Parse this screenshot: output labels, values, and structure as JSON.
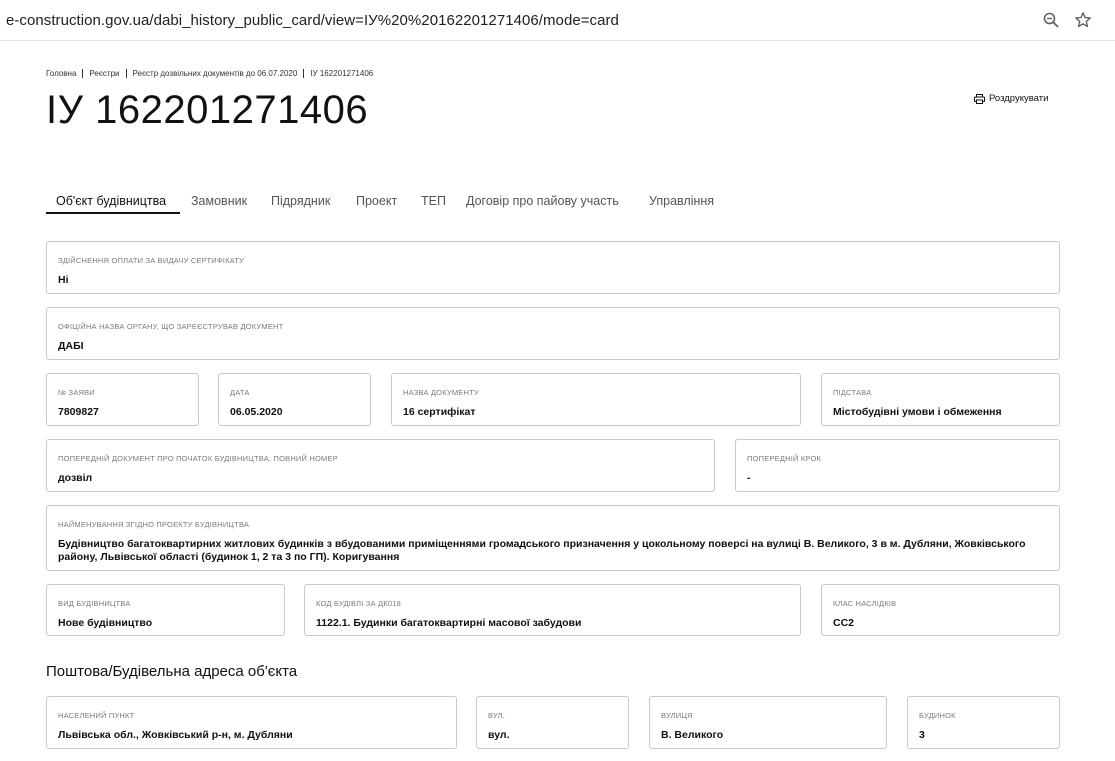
{
  "browser": {
    "url": "e-construction.gov.ua/dabi_history_public_card/view=ІУ%20%20162201271406/mode=card"
  },
  "breadcrumbs": [
    "Головна",
    "Реєстри",
    "Реєстр дозвільних документів до 06.07.2020",
    "ІУ 162201271406"
  ],
  "page": {
    "title": "ІУ 162201271406",
    "print_label": "Роздрукувати"
  },
  "tabs": [
    {
      "label": "Об'єкт будівництва",
      "active": true
    },
    {
      "label": "Замовник"
    },
    {
      "label": "Підрядник"
    },
    {
      "label": "Проект"
    },
    {
      "label": "ТЕП"
    },
    {
      "label": "Договір про пайову участь"
    },
    {
      "label": "Управління"
    }
  ],
  "fields": {
    "payment": {
      "label": "Здійснення оплати за видачу сертифікату",
      "value": "Ні"
    },
    "authority": {
      "label": "Офіційна назва органу, що зареєстрував документ",
      "value": "ДАБІ"
    },
    "application_no": {
      "label": "№ заяви",
      "value": "7809827"
    },
    "date": {
      "label": "Дата",
      "value": "06.05.2020"
    },
    "doc_name": {
      "label": "Назва документу",
      "value": "16 сертифікат"
    },
    "basis": {
      "label": "Підстава",
      "value": "Містобудівні умови і обмеження"
    },
    "prev_doc": {
      "label": "Попередній документ про початок будівництва, повний номер",
      "value": "дозвіл"
    },
    "prev_step": {
      "label": "Попередній крок",
      "value": "-"
    },
    "project_name": {
      "label": "Найменування згідно проекту будівництва",
      "value": "Будівництво багатоквартирних житлових будинків з вбудованими приміщеннями громадського призначення у цокольному поверсі на вулиці В. Великого, 3 в м. Дубляни, Жовківського району, Львівської області (будинок 1, 2 та 3 по ГП). Коригування"
    },
    "construction_type": {
      "label": "Вид будівництва",
      "value": "Нове будівництво"
    },
    "building_code": {
      "label": "Код будівлі за ДК018",
      "value": "1122.1. Будинки багатоквартирні масової забудови"
    },
    "consequence_class": {
      "label": "Клас наслідків",
      "value": "СС2"
    }
  },
  "address": {
    "title": "Поштова/Будівельна адреса об'єкта",
    "locality": {
      "label": "Населений пункт",
      "value": "Львівська обл., Жовківський р-н, м. Дубляни"
    },
    "street_type": {
      "label": "Вул.",
      "value": "вул."
    },
    "street": {
      "label": "Вулиця",
      "value": "В. Великого"
    },
    "building": {
      "label": "Будинок",
      "value": "3"
    }
  },
  "icons": {
    "zoom": "zoom-icon",
    "bookmark": "star-icon",
    "print": "printer-icon"
  }
}
